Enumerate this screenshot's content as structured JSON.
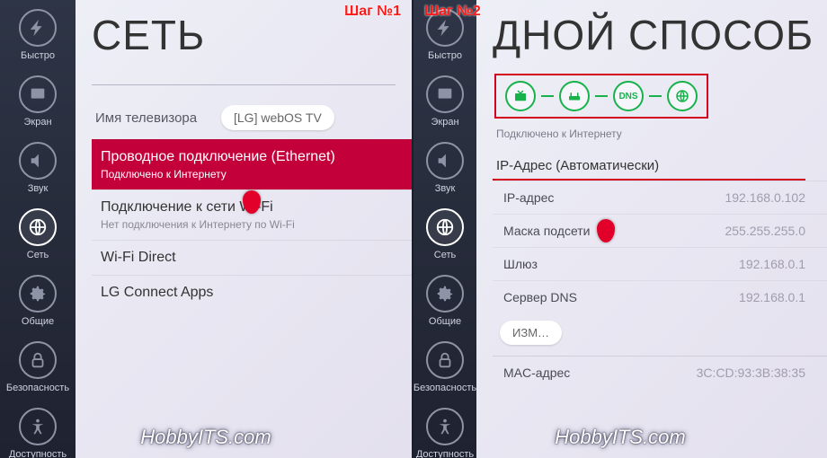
{
  "step1_label": "Шаг №1",
  "step2_label": "Шаг №2",
  "watermark": "HobbyITS.com",
  "sidebar": {
    "items": [
      {
        "label": "Быстро"
      },
      {
        "label": "Экран"
      },
      {
        "label": "Звук"
      },
      {
        "label": "Сеть"
      },
      {
        "label": "Общие"
      },
      {
        "label": "Безопасность"
      },
      {
        "label": "Доступность"
      }
    ]
  },
  "step1": {
    "title": "СЕТЬ",
    "tvname_label": "Имя телевизора",
    "tvname_value": "[LG] webOS TV",
    "items": [
      {
        "title": "Проводное подключение (Ethernet)",
        "sub": "Подключено к Интернету",
        "selected": true
      },
      {
        "title": "Подключение к сети Wi-Fi",
        "sub": "Нет подключения к Интернету по Wi-Fi"
      },
      {
        "title": "Wi-Fi Direct"
      },
      {
        "title": "LG Connect Apps"
      }
    ]
  },
  "step2": {
    "title": "ДНОЙ СПОСОБ",
    "dns_badge": "DNS",
    "connected": "Подключено к Интернету",
    "section": "IP-Адрес (Автоматически)",
    "rows": [
      {
        "k": "IP-адрес",
        "v": "192.168.0.102"
      },
      {
        "k": "Маска подсети",
        "v": "255.255.255.0"
      },
      {
        "k": "Шлюз",
        "v": "192.168.0.1"
      },
      {
        "k": "Сервер DNS",
        "v": "192.168.0.1"
      }
    ],
    "edit_btn": "ИЗМ…",
    "mac_label": "MAC-адрес",
    "mac_value": "3C:CD:93:3B:38:35"
  }
}
